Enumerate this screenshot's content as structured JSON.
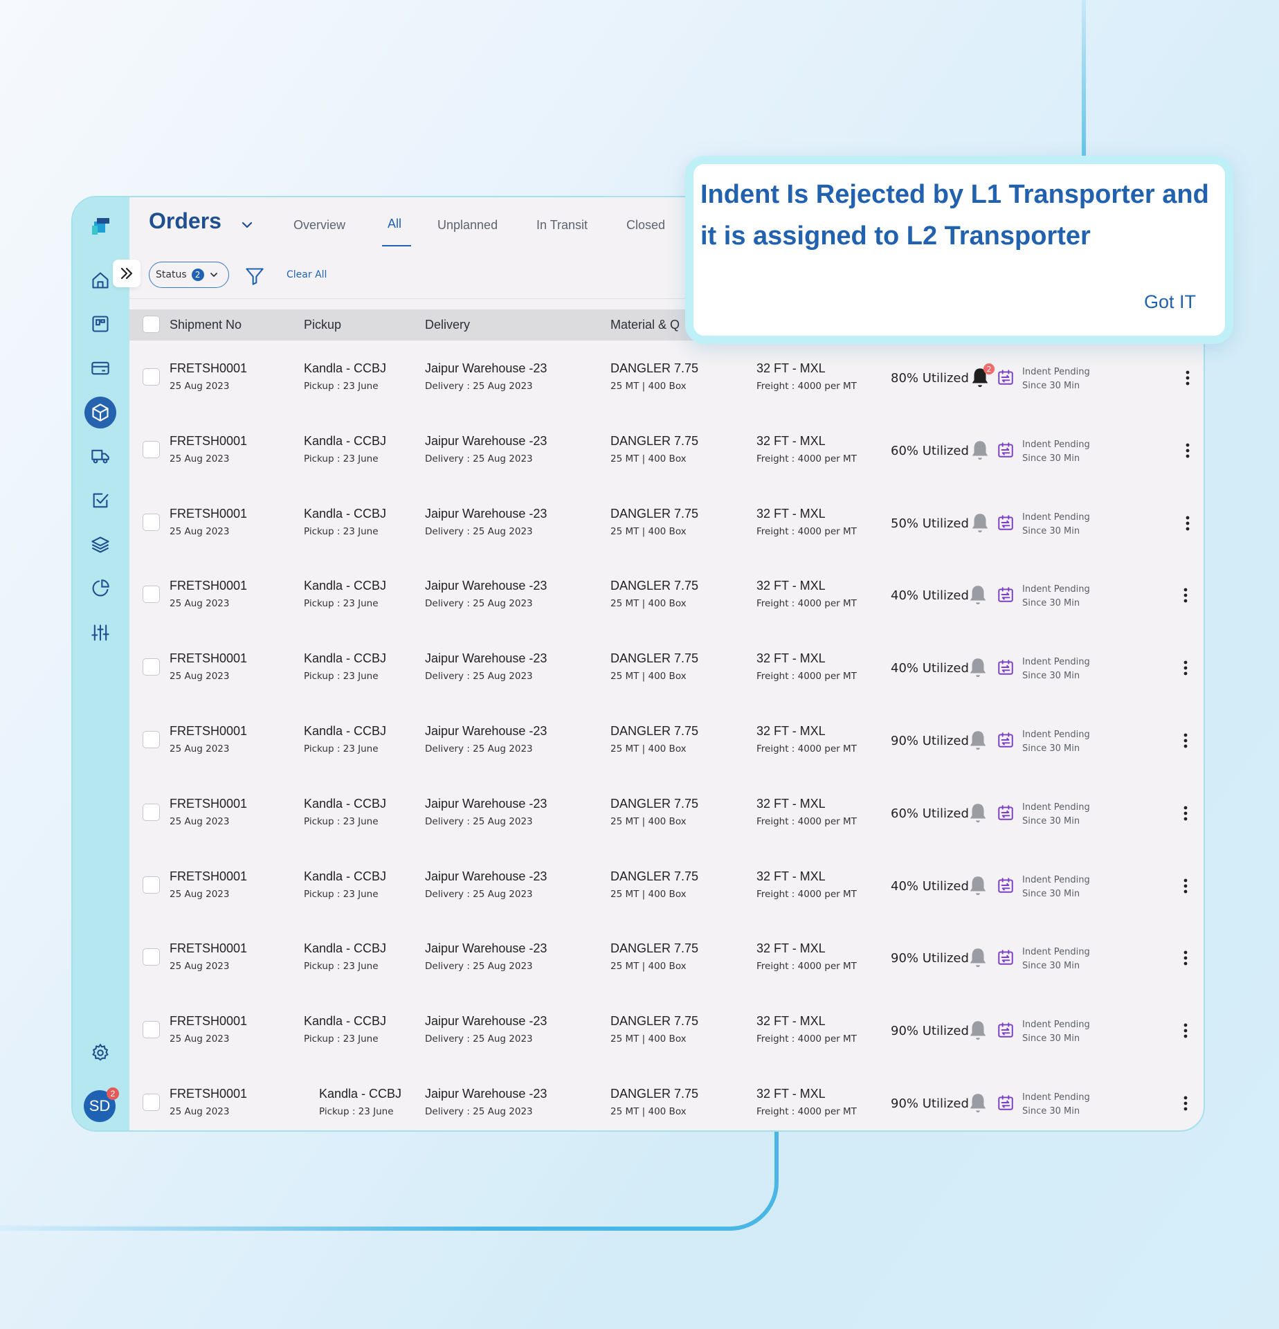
{
  "app": {
    "title": "Orders",
    "tabs": [
      {
        "label": "Overview"
      },
      {
        "label": "All"
      },
      {
        "label": "Unplanned"
      },
      {
        "label": "In Transit"
      },
      {
        "label": "Closed"
      }
    ],
    "active_tab": "All",
    "filter": {
      "status_label": "Status",
      "status_count": "2",
      "clear_all": "Clear All"
    },
    "columns": [
      "Shipment No",
      "Pickup",
      "Delivery",
      "Material & Q"
    ],
    "user": {
      "initials": "SD",
      "notification_count": "2"
    },
    "accent_color": "#1f62b3",
    "sidebar_color": "#b4e7ef"
  },
  "rows": [
    {
      "id": "FRETSH0001",
      "date": "25 Aug 2023",
      "pickup": "Kandla - CCBJ",
      "pickup_sub": "Pickup : 23 June",
      "delivery": "Jaipur Warehouse -23",
      "delivery_sub": "Delivery : 25 Aug 2023",
      "material": "DANGLER 7.75",
      "material_sub": "25 MT | 400 Box",
      "vehicle": "32 FT - MXL",
      "vehicle_sub": "Freight : 4000 per MT",
      "utilization": "80% Utilized",
      "indent_status": "Indent Pending",
      "indent_since": "Since 30 Min",
      "notification_count": "2"
    },
    {
      "id": "FRETSH0001",
      "date": "25 Aug 2023",
      "pickup": "Kandla - CCBJ",
      "pickup_sub": "Pickup : 23 June",
      "delivery": "Jaipur Warehouse -23",
      "delivery_sub": "Delivery : 25 Aug 2023",
      "material": "DANGLER 7.75",
      "material_sub": "25 MT | 400 Box",
      "vehicle": "32 FT - MXL",
      "vehicle_sub": "Freight : 4000 per MT",
      "utilization": "60% Utilized",
      "indent_status": "Indent Pending",
      "indent_since": "Since 30 Min"
    },
    {
      "id": "FRETSH0001",
      "date": "25 Aug 2023",
      "pickup": "Kandla - CCBJ",
      "pickup_sub": "Pickup : 23 June",
      "delivery": "Jaipur Warehouse -23",
      "delivery_sub": "Delivery : 25 Aug 2023",
      "material": "DANGLER 7.75",
      "material_sub": "25 MT | 400 Box",
      "vehicle": "32 FT - MXL",
      "vehicle_sub": "Freight : 4000 per MT",
      "utilization": "50% Utilized",
      "indent_status": "Indent Pending",
      "indent_since": "Since 30 Min"
    },
    {
      "id": "FRETSH0001",
      "date": "25 Aug 2023",
      "pickup": "Kandla - CCBJ",
      "pickup_sub": "Pickup : 23 June",
      "delivery": "Jaipur Warehouse -23",
      "delivery_sub": "Delivery : 25 Aug 2023",
      "material": "DANGLER 7.75",
      "material_sub": "25 MT | 400 Box",
      "vehicle": "32 FT - MXL",
      "vehicle_sub": "Freight : 4000 per MT",
      "utilization": "40% Utilized",
      "indent_status": "Indent Pending",
      "indent_since": "Since 30 Min"
    },
    {
      "id": "FRETSH0001",
      "date": "25 Aug 2023",
      "pickup": "Kandla - CCBJ",
      "pickup_sub": "Pickup : 23 June",
      "delivery": "Jaipur Warehouse -23",
      "delivery_sub": "Delivery : 25 Aug 2023",
      "material": "DANGLER 7.75",
      "material_sub": "25 MT | 400 Box",
      "vehicle": "32 FT - MXL",
      "vehicle_sub": "Freight : 4000 per MT",
      "utilization": "40% Utilized",
      "indent_status": "Indent Pending",
      "indent_since": "Since 30 Min"
    },
    {
      "id": "FRETSH0001",
      "date": "25 Aug 2023",
      "pickup": "Kandla - CCBJ",
      "pickup_sub": "Pickup : 23 June",
      "delivery": "Jaipur Warehouse -23",
      "delivery_sub": "Delivery : 25 Aug 2023",
      "material": "DANGLER 7.75",
      "material_sub": "25 MT | 400 Box",
      "vehicle": "32 FT - MXL",
      "vehicle_sub": "Freight : 4000 per MT",
      "utilization": "90% Utilized",
      "indent_status": "Indent Pending",
      "indent_since": "Since 30 Min"
    },
    {
      "id": "FRETSH0001",
      "date": "25 Aug 2023",
      "pickup": "Kandla - CCBJ",
      "pickup_sub": "Pickup : 23 June",
      "delivery": "Jaipur Warehouse -23",
      "delivery_sub": "Delivery : 25 Aug 2023",
      "material": "DANGLER 7.75",
      "material_sub": "25 MT | 400 Box",
      "vehicle": "32 FT - MXL",
      "vehicle_sub": "Freight : 4000 per MT",
      "utilization": "60% Utilized",
      "indent_status": "Indent Pending",
      "indent_since": "Since 30 Min"
    },
    {
      "id": "FRETSH0001",
      "date": "25 Aug 2023",
      "pickup": "Kandla - CCBJ",
      "pickup_sub": "Pickup : 23 June",
      "delivery": "Jaipur Warehouse -23",
      "delivery_sub": "Delivery : 25 Aug 2023",
      "material": "DANGLER 7.75",
      "material_sub": "25 MT | 400 Box",
      "vehicle": "32 FT - MXL",
      "vehicle_sub": "Freight : 4000 per MT",
      "utilization": "40% Utilized",
      "indent_status": "Indent Pending",
      "indent_since": "Since 30 Min"
    },
    {
      "id": "FRETSH0001",
      "date": "25 Aug 2023",
      "pickup": "Kandla - CCBJ",
      "pickup_sub": "Pickup : 23 June",
      "delivery": "Jaipur Warehouse -23",
      "delivery_sub": "Delivery : 25 Aug 2023",
      "material": "DANGLER 7.75",
      "material_sub": "25 MT | 400 Box",
      "vehicle": "32 FT - MXL",
      "vehicle_sub": "Freight : 4000 per MT",
      "utilization": "90% Utilized",
      "indent_status": "Indent Pending",
      "indent_since": "Since 30 Min"
    },
    {
      "id": "FRETSH0001",
      "date": "25 Aug 2023",
      "pickup": "Kandla - CCBJ",
      "pickup_sub": "Pickup : 23 June",
      "delivery": "Jaipur Warehouse -23",
      "delivery_sub": "Delivery : 25 Aug 2023",
      "material": "DANGLER 7.75",
      "material_sub": "25 MT | 400 Box",
      "vehicle": "32 FT - MXL",
      "vehicle_sub": "Freight : 4000 per MT",
      "utilization": "90% Utilized",
      "indent_status": "Indent Pending",
      "indent_since": "Since 30 Min"
    },
    {
      "id": "FRETSH0001",
      "date": "25 Aug 2023",
      "pickup": "Kandla - CCBJ",
      "pickup_sub": "Pickup : 23 June",
      "delivery": "Jaipur Warehouse -23",
      "delivery_sub": "Delivery : 25 Aug 2023",
      "material": "DANGLER 7.75",
      "material_sub": "25 MT | 400 Box",
      "vehicle": "32 FT - MXL",
      "vehicle_sub": "Freight : 4000 per MT",
      "utilization": "90% Utilized",
      "indent_status": "Indent Pending",
      "indent_since": "Since 30 Min"
    }
  ],
  "popup": {
    "message": "Indent Is Rejected by L1 Transporter and it is assigned to L2 Transporter",
    "button": "Got IT"
  },
  "icons": {
    "sidebar": [
      "home-icon",
      "dashboard-icon",
      "card-icon",
      "package-icon",
      "truck-icon",
      "checklist-icon",
      "layers-icon",
      "pie-chart-icon",
      "sliders-icon",
      "settings-icon"
    ],
    "row": [
      "calendar-transfer-icon",
      "bell-icon",
      "more-vertical-icon"
    ]
  }
}
